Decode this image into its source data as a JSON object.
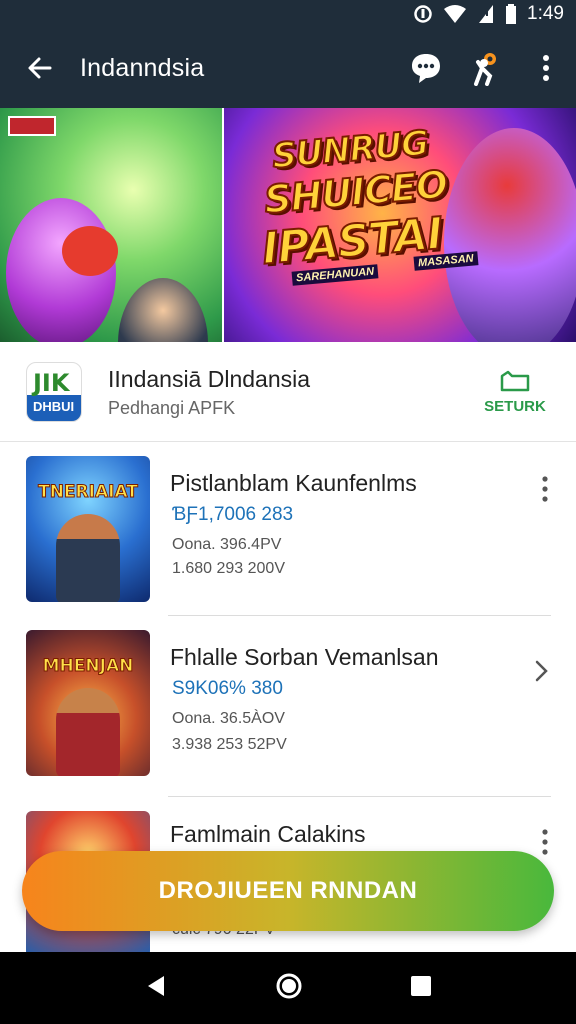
{
  "status_bar": {
    "time": "1:49"
  },
  "app_bar": {
    "title": "Indanndsia"
  },
  "banner": {
    "left_badge": "",
    "line1": "SUNRUG",
    "line2": "SHUICEO",
    "line3": "IPASTAI",
    "tag_left": "SAREHANUAN",
    "tag_right": "MASASAN"
  },
  "app_header": {
    "logo_top": "JIK",
    "logo_bottom": "DHBUI",
    "name": "IIndansiā Dlndansia",
    "subtitle": "Pedhangi APFK",
    "setup_label": "SETURK"
  },
  "items": [
    {
      "thumb_title": "TNERIAIAT",
      "title": "Pistlanblam Kaunfenlms",
      "line1": "ƁƑ1,7006 283",
      "line2": "Oona. 396.4PV",
      "line3": "1.680 293 200V",
      "action": "more"
    },
    {
      "thumb_title": "MHENJAN",
      "title": "Fhlalle Sorban Vemanlsan",
      "line1": "S9K06% 380",
      "line2": "Oona. 36.5ÀOV",
      "line3": "3.938 253 52PV",
      "action": "chevron"
    },
    {
      "thumb_title": "",
      "title": "Famlmain Calakins",
      "line1": "",
      "line2": "",
      "line3": "сulс 790 22PV",
      "action": "more"
    }
  ],
  "cta": {
    "label": "DROJIUEEN RNNDAN"
  },
  "colors": {
    "app_bar": "#1f2d3a",
    "accent_green": "#2a9a49",
    "link_blue": "#1d72b8",
    "cta_start": "#f7841c",
    "cta_end": "#49b83c"
  }
}
